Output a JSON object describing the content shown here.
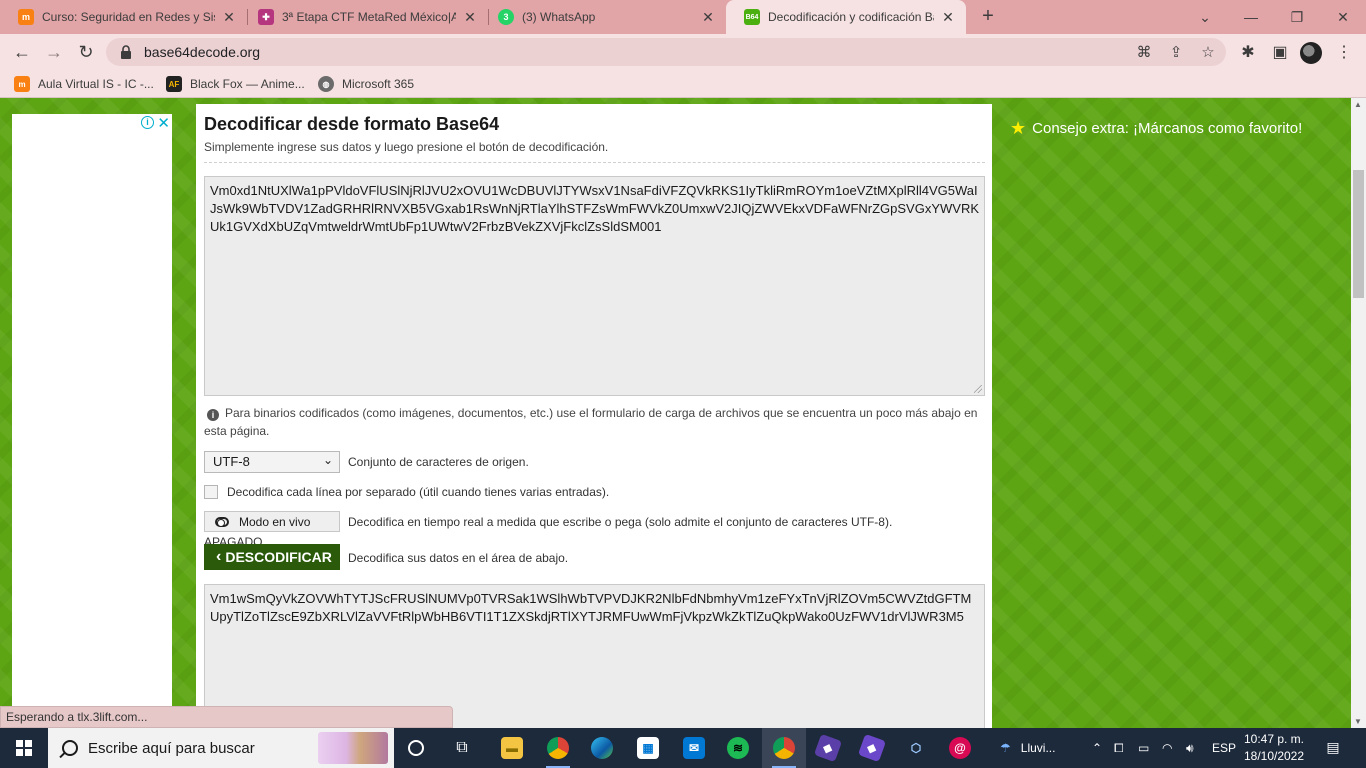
{
  "browser": {
    "tabs": [
      {
        "title": "Curso: Seguridad en Redes y Siste",
        "favicon": "moodle-icon",
        "active": false
      },
      {
        "title": "3ª Etapa CTF MetaRed México|Ar",
        "favicon": "puzzle-icon",
        "active": false
      },
      {
        "title": "(3) WhatsApp",
        "favicon": "whatsapp-icon",
        "badge": "3",
        "active": false
      },
      {
        "title": "Decodificación y codificación Ba",
        "favicon": "base64-icon",
        "favicon_text": "B64",
        "active": true
      }
    ],
    "new_tab": "+",
    "window_controls": {
      "minimize": "⌄",
      "restore": "❐",
      "close": "✕",
      "tab_search": "⌄"
    },
    "url": "base64decode.org",
    "bookmarks": [
      {
        "label": "Aula Virtual IS - IC -...",
        "icon": "moodle-icon"
      },
      {
        "label": "Black Fox — Anime...",
        "icon": "blackfox-icon",
        "icon_text": "AF"
      },
      {
        "label": "Microsoft 365",
        "icon": "globe-icon"
      }
    ],
    "status_text": "Esperando a tlx.3lift.com..."
  },
  "page": {
    "title": "Decodificar desde formato Base64",
    "subtitle": "Simplemente ingrese sus datos y luego presione el botón de decodificación.",
    "input_text": "Vm0xd1NtUXlWa1pPVldoVFlUSlNjRlJVU2xOVU1WcDBUVlJTYWsxV1NsaFdiVFZQVkRKS1IyTkliRmROYm1oeVZtMXplRll4VG5WaIJsWk9WbTVDV1ZadGRHRlRNVXB5VGxab1RsWnNjRTlaYlhSTFZsWmFWVkZ0UmxwV2JIQjZWVEkxVDFaWFNrZGpSVGxYWVRKUk1GVXdXbUZqVmtweldrWmtUbFp1UWtwV2FrbzBVekZXVjFkclZsSldSM001",
    "info_icon": "i",
    "info_text": "Para binarios codificados (como imágenes, documentos, etc.) use el formulario de carga de archivos que se encuentra un poco más abajo en esta página.",
    "charset_value": "UTF-8",
    "charset_label": "Conjunto de caracteres de origen.",
    "per_line_label": "Decodifica cada línea por separado (útil cuando tienes varias entradas).",
    "per_line_checked": false,
    "live_button": "Modo en vivo",
    "live_state": "APAGADO",
    "live_label": "Decodifica en tiempo real a medida que escribe o pega (solo admite el conjunto de caracteres UTF-8).",
    "decode_button": "DESCODIFICAR",
    "decode_arrow": "‹",
    "decode_label": "Decodifica sus datos en el área de abajo.",
    "output_text": "Vm1wSmQyVkZOVWhTYTJScFRUSlNUMVp0TVRSak1WSlhWbTVPVDJKR2NlbFdNbmhyVm1zeFYxTnVjRlZOVm5CWVZtdGFTMUpyTlZoTlZscE9ZbXRLVlZaVVFtRlpWbHB6VTI1T1ZXSkdjRTlXYTJRMFUwWmFjVkpzWkZkTlZuQkpWako0UzFWV1drVlJWR3M5",
    "tip": "Consejo extra: ¡Márcanos como favorito!",
    "ad_info": "i",
    "ad_close": "✕"
  },
  "taskbar": {
    "search_placeholder": "Escribe aquí para buscar",
    "weather_label": "Lluvi...",
    "language": "ESP",
    "time": "10:47 p. m.",
    "date": "18/10/2022"
  },
  "colors": {
    "page_green": "#5da513",
    "button_dark_green": "#2b5a0a",
    "tab_bar": "#e1a4a7",
    "taskbar": "#1d2a3c"
  }
}
